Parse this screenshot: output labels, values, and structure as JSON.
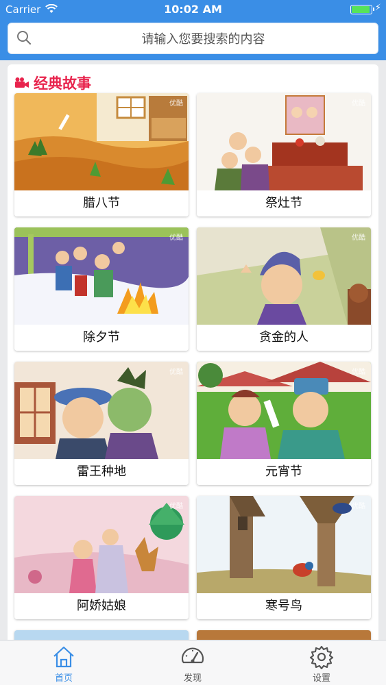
{
  "status_bar": {
    "carrier": "Carrier",
    "time": "10:02 AM",
    "battery_level": 0.95
  },
  "search": {
    "placeholder": "请输入您要搜索的内容"
  },
  "section": {
    "title": "经典故事",
    "icon": "video-camera-icon"
  },
  "stories": [
    {
      "title": "腊八节"
    },
    {
      "title": "祭灶节"
    },
    {
      "title": "除夕节"
    },
    {
      "title": "贪金的人"
    },
    {
      "title": "雷王种地"
    },
    {
      "title": "元宵节"
    },
    {
      "title": "阿娇姑娘"
    },
    {
      "title": "寒号鸟"
    }
  ],
  "tabbar": {
    "items": [
      {
        "label": "首页",
        "icon": "home-icon",
        "active": true
      },
      {
        "label": "发现",
        "icon": "speedometer-icon",
        "active": false
      },
      {
        "label": "设置",
        "icon": "gear-icon",
        "active": false
      }
    ]
  },
  "colors": {
    "accent": "#3a8ee6",
    "section_title": "#e8244d",
    "tab_inactive": "#555555"
  }
}
